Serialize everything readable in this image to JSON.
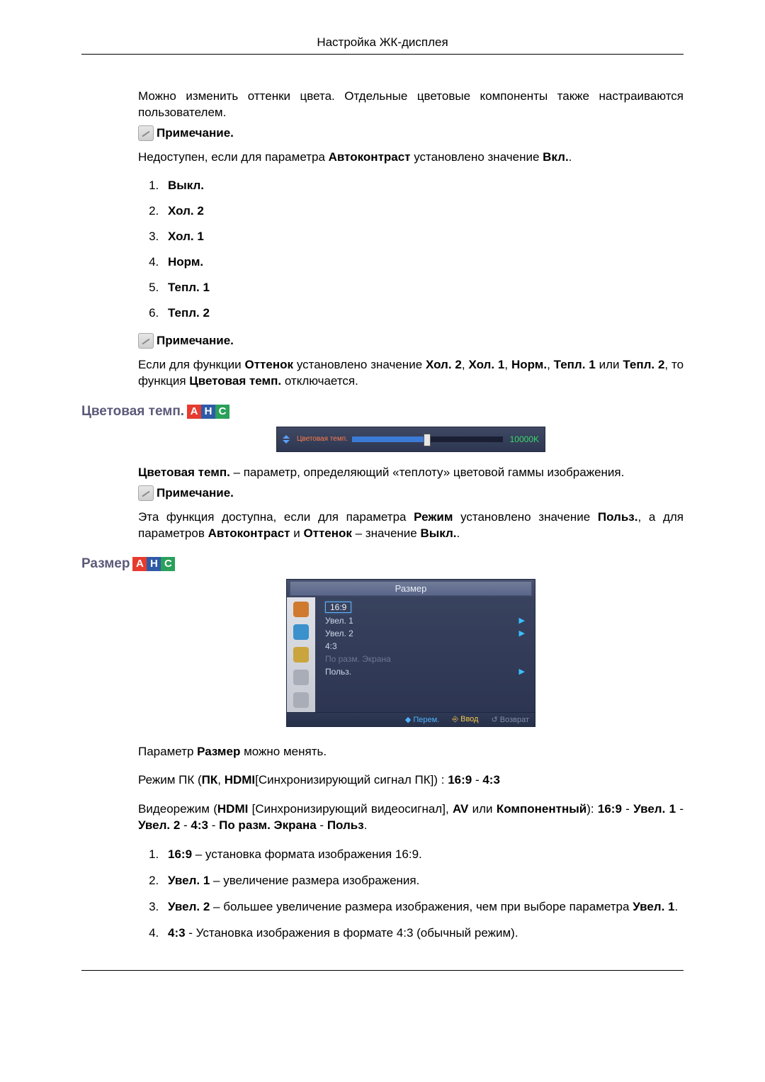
{
  "header": {
    "title": "Настройка ЖК-дисплея"
  },
  "intro": "Можно изменить оттенки цвета. Отдельные цветовые компоненты также настраиваются пользователем.",
  "note_label": "Примечание.",
  "unavail": {
    "t1": "Недоступен, если для параметра ",
    "b1": "Автоконтраст ",
    "t2": "установлено значение ",
    "b2": "Вкл.",
    "dot": "."
  },
  "tone_options": [
    "Выкл.",
    "Хол. 2",
    "Хол. 1",
    "Норм.",
    "Тепл. 1",
    "Тепл. 2"
  ],
  "tone_note": {
    "t1": "Если для функции ",
    "b1": "Оттенок ",
    "t2": "установлено значение ",
    "b2": "Хол. 2",
    "c1": ", ",
    "b3": "Хол. 1",
    "c2": ", ",
    "b4": "Норм.",
    "c3": ", ",
    "b5": "Тепл. 1",
    "t3": " или ",
    "b6": "Тепл. 2",
    "t4": ", то функция ",
    "b7": "Цветовая темп.",
    "t5": " отключается."
  },
  "section_color_temp": {
    "title": "Цветовая темп."
  },
  "badges": {
    "a": "A",
    "h": "H",
    "c": "C"
  },
  "osd_slider": {
    "label": "Цветовая темп.",
    "value": "10000K"
  },
  "color_temp_desc": {
    "b1": "Цветовая темп.",
    "t1": " – параметр, определяющий «теплоту» цветовой гаммы изображения."
  },
  "color_temp_avail": {
    "t1": "Эта функция доступна, если для параметра ",
    "b1": "Режим ",
    "t2": "установлено значение ",
    "b2": "Польз.",
    "t3": ", а для параметров ",
    "b3": "Автоконтраст",
    "t4": " и ",
    "b4": "Оттенок",
    "t5": " – значение ",
    "b5": "Выкл.",
    "dot": "."
  },
  "section_size": {
    "title": "Размер"
  },
  "osd_menu": {
    "title": "Размер",
    "items": {
      "i0": "16:9",
      "i1": "Увел. 1",
      "i2": "Увел. 2",
      "i3": "4:3",
      "i4": "По разм. Экрана",
      "i5": "Польз."
    },
    "footer": {
      "move": "Перем.",
      "enter": "Ввод",
      "back": "Возврат"
    }
  },
  "size_desc": {
    "t1": "Параметр ",
    "b1": "Размер",
    "t2": " можно менять."
  },
  "pc_mode": {
    "t1": "Режим ПК (",
    "b1": "ПК",
    "c1": ", ",
    "b2": "HDMI",
    "t2": "[Синхронизирующий сигнал ПК]) : ",
    "b3": "16:9",
    "d1": " - ",
    "b4": "4:3"
  },
  "video_mode": {
    "t1": "Видеорежим (",
    "b1": "HDMI",
    "t2": " [Синхронизирующий видеосигнал], ",
    "b2": "AV",
    "t3": " или ",
    "b3": "Компонентный",
    "t4": "): ",
    "b4": "16:9",
    "d": " - ",
    "b5": "Увел. 1",
    "b6": "Увел. 2",
    "b7": "4:3",
    "b8": "По разм. Экрана",
    "b9": "Польз",
    "dot": "."
  },
  "size_list": {
    "i1": {
      "b": "16:9",
      "t": " – установка формата изображения 16:9."
    },
    "i2": {
      "b": "Увел. 1",
      "t": " – увеличение размера изображения."
    },
    "i3": {
      "b": "Увел. 2",
      "t": " – большее увеличение размера изображения, чем при выборе параметра ",
      "b2": "Увел. 1",
      "dot": "."
    },
    "i4": {
      "b": "4:3",
      "t": " - Установка изображения в формате 4:3 (обычный режим)."
    }
  }
}
